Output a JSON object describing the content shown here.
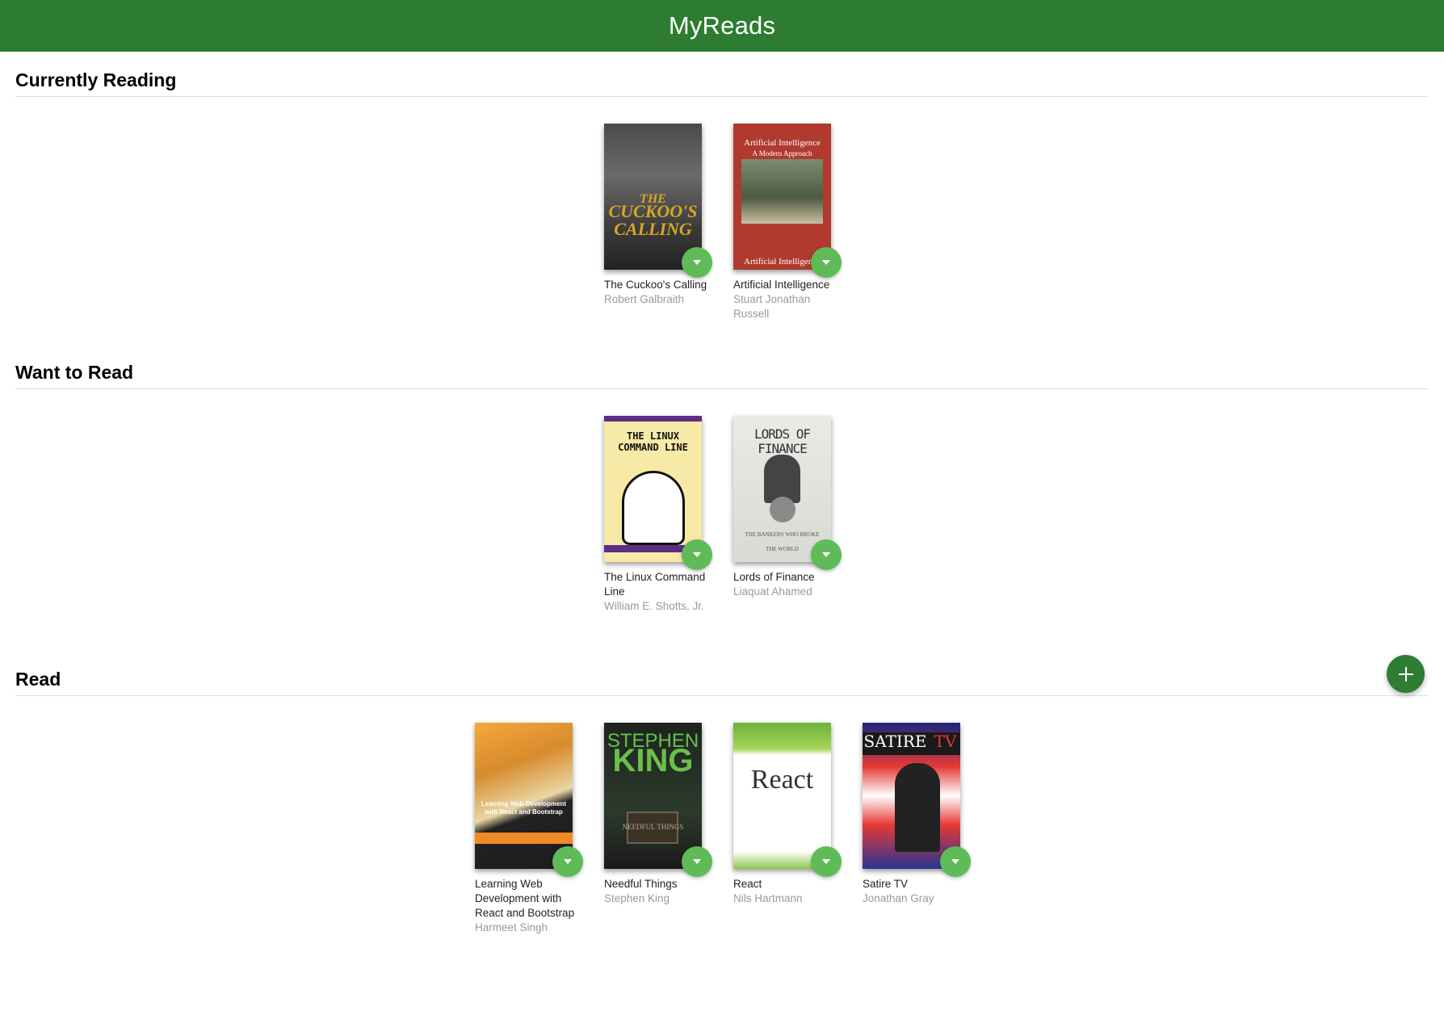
{
  "app": {
    "title": "MyReads"
  },
  "shelves": [
    {
      "title": "Currently Reading",
      "books": [
        {
          "title": "The Cuckoo's Calling",
          "author": "Robert Galbraith",
          "cover_text": [
            "THE",
            "CUCKOO'S",
            "CALLING"
          ]
        },
        {
          "title": "Artificial Intelligence",
          "author": "Stuart Jonathan Russell",
          "cover_text": [
            "Artificial Intelligence",
            "A Modern Approach"
          ]
        }
      ]
    },
    {
      "title": "Want to Read",
      "books": [
        {
          "title": "The Linux Command Line",
          "author": "William E. Shotts, Jr.",
          "cover_text": [
            "THE LINUX",
            "COMMAND LINE"
          ]
        },
        {
          "title": "Lords of Finance",
          "author": "Liaquat Ahamed",
          "cover_text": [
            "LORDS OF FINANCE",
            "THE BANKERS WHO BROKE THE WORLD"
          ]
        }
      ]
    },
    {
      "title": "Read",
      "books": [
        {
          "title": "Learning Web Development with React and Bootstrap",
          "author": "Harmeet Singh",
          "cover_text": [
            "Learning Web Development",
            "with React and Bootstrap"
          ]
        },
        {
          "title": "Needful Things",
          "author": "Stephen King",
          "cover_text": [
            "STEPHEN",
            "KING",
            "NEEDFUL THINGS"
          ]
        },
        {
          "title": "React",
          "author": "Nils Hartmann",
          "cover_text": [
            "React"
          ]
        },
        {
          "title": "Satire TV",
          "author": "Jonathan Gray",
          "cover_text": [
            "SATIRE",
            "TV"
          ]
        }
      ]
    }
  ],
  "icons": {
    "shelf_changer": "arrow-drop-down-icon",
    "add_book": "plus-icon"
  },
  "colors": {
    "app_bar": "#2e7c31",
    "changer_button": "#5fbb58",
    "add_button": "#2e7d32"
  }
}
